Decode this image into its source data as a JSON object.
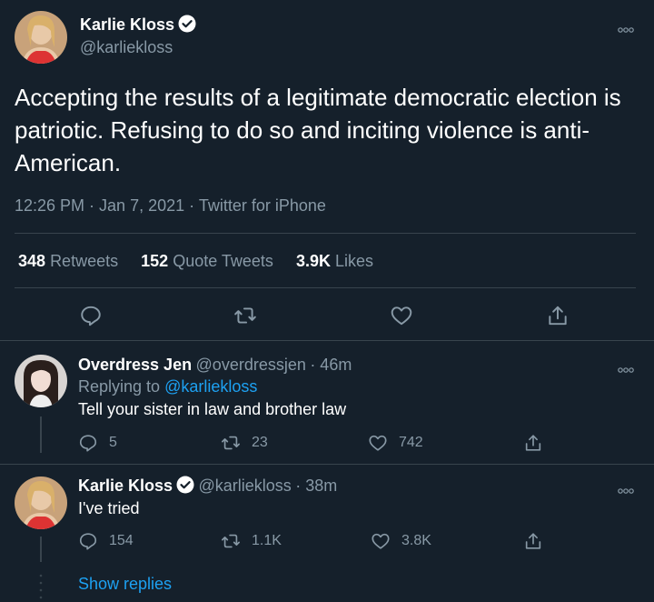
{
  "tweet": {
    "author_name": "Karlie Kloss",
    "author_handle": "@karliekloss",
    "text": "Accepting the results of a legitimate democratic election is patriotic. Refusing to do so and inciting violence is anti-American.",
    "timestamp": "12:26 PM · Jan 7, 2021",
    "separator": "·",
    "source": "Twitter for iPhone",
    "retweets_count": "348",
    "retweets_label": "Retweets",
    "quotes_count": "152",
    "quotes_label": "Quote Tweets",
    "likes_count": "3.9K",
    "likes_label": "Likes"
  },
  "replies": [
    {
      "author_name": "Overdress Jen",
      "author_handle": "@overdressjen",
      "time": "· 46m",
      "replying_prefix": "Replying to",
      "replying_to": "@karliekloss",
      "text": "Tell your sister in law and brother law",
      "reply_count": "5",
      "retweet_count": "23",
      "like_count": "742"
    },
    {
      "author_name": "Karlie Kloss",
      "author_handle": "@karliekloss",
      "time": "· 38m",
      "text": "I've tried",
      "reply_count": "154",
      "retweet_count": "1.1K",
      "like_count": "3.8K"
    }
  ],
  "show_replies_label": "Show replies",
  "icons": {
    "reply": "reply-icon",
    "retweet": "retweet-icon",
    "like": "heart-icon",
    "share": "share-icon",
    "more": "more-icon",
    "verified": "verified-badge-icon"
  },
  "colors": {
    "background": "#15202b",
    "accent": "#1da1f2",
    "muted": "#8899a6",
    "divider": "#38444d"
  }
}
